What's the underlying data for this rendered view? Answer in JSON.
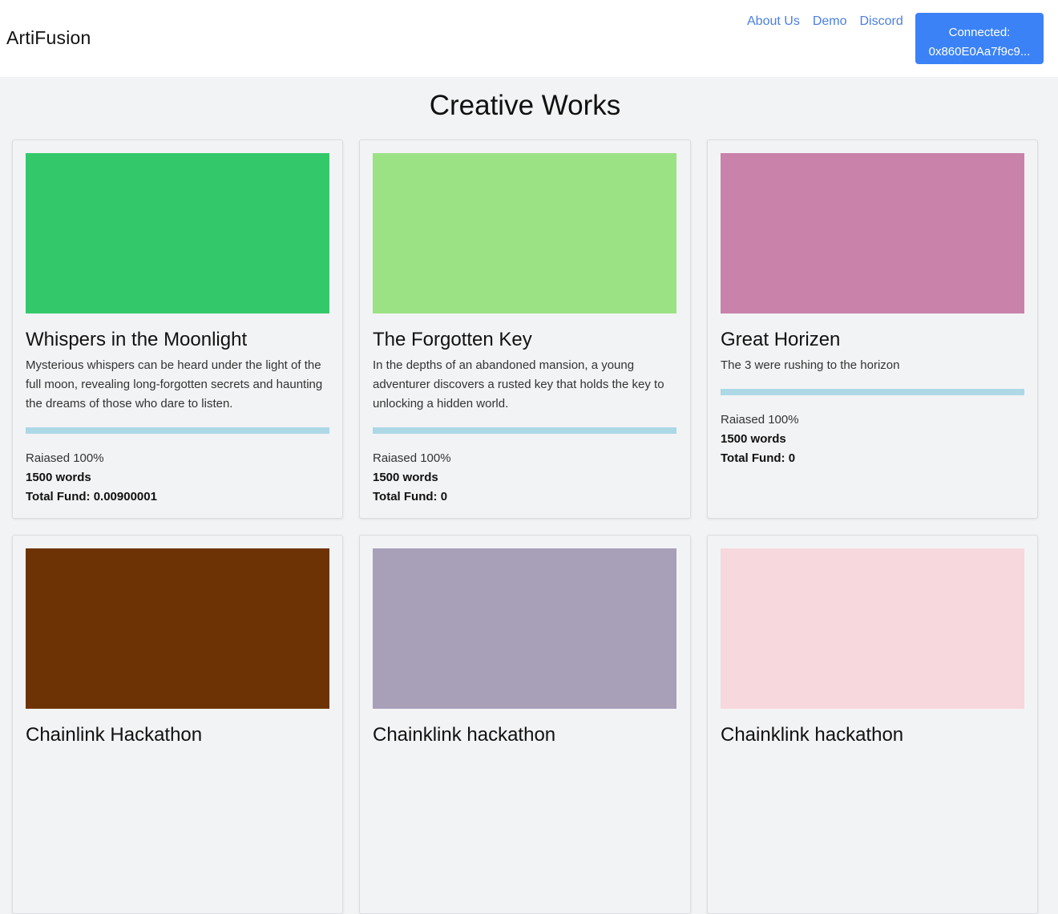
{
  "header": {
    "brand": "ArtiFusion",
    "links": [
      "About Us",
      "Demo",
      "Discord"
    ],
    "connect_line1": "Connected:",
    "connect_line2": "0x860E0Aa7f9c9..."
  },
  "page_title": "Creative Works",
  "cards": [
    {
      "color": "#33c96a",
      "title": "Whispers in the Moonlight",
      "description": "Mysterious whispers can be heard under the light of the full moon, revealing long-forgotten secrets and haunting the dreams of those who dare to listen.",
      "progress_percent": 100,
      "raised": "Raiased 100%",
      "words": "1500 words",
      "fund": "Total Fund: 0.00900001"
    },
    {
      "color": "#9be285",
      "title": "The Forgotten Key",
      "description": "In the depths of an abandoned mansion, a young adventurer discovers a rusted key that holds the key to unlocking a hidden world.",
      "progress_percent": 100,
      "raised": "Raiased 100%",
      "words": "1500 words",
      "fund": "Total Fund: 0"
    },
    {
      "color": "#c982aa",
      "title": "Great Horizen",
      "description": "The 3 were rushing to the horizon",
      "progress_percent": 100,
      "raised": "Raiased 100%",
      "words": "1500 words",
      "fund": "Total Fund: 0"
    },
    {
      "color": "#6e3304",
      "title": "Chainlink Hackathon"
    },
    {
      "color": "#a89fb9",
      "title": "Chainklink hackathon"
    },
    {
      "color": "#f7d8dc",
      "title": "Chainklink hackathon"
    }
  ]
}
